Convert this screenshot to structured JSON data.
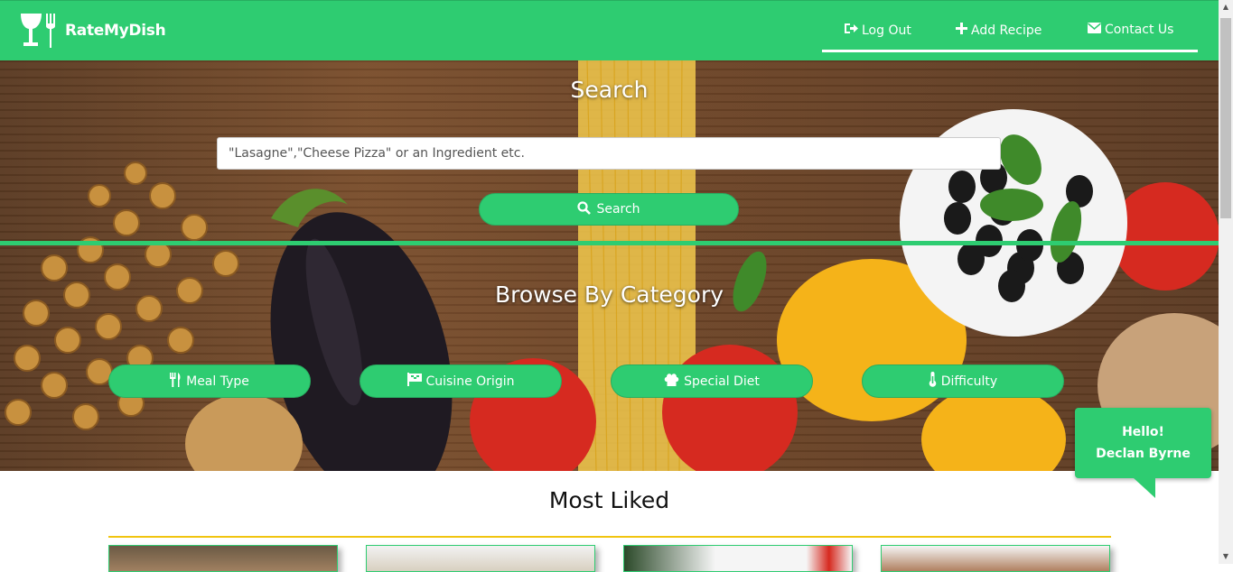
{
  "brand": {
    "name": "RateMyDish"
  },
  "nav": {
    "logout": "Log Out",
    "add_recipe": "Add Recipe",
    "contact": "Contact Us"
  },
  "search": {
    "title": "Search",
    "placeholder": "\"Lasagne\",\"Cheese Pizza\" or an Ingredient etc.",
    "button": "Search"
  },
  "browse": {
    "title": "Browse By Category",
    "categories": [
      {
        "label": "Meal Type",
        "icon": "cutlery-icon"
      },
      {
        "label": "Cuisine Origin",
        "icon": "flag-icon"
      },
      {
        "label": "Special Diet",
        "icon": "chef-hat-icon"
      },
      {
        "label": "Difficulty",
        "icon": "thermometer-icon"
      }
    ]
  },
  "greeting": {
    "line1": "Hello!",
    "line2": "Declan Byrne"
  },
  "most_liked": {
    "title": "Most Liked"
  },
  "colors": {
    "primary": "#2ecc71",
    "accent": "#f1c40f"
  }
}
